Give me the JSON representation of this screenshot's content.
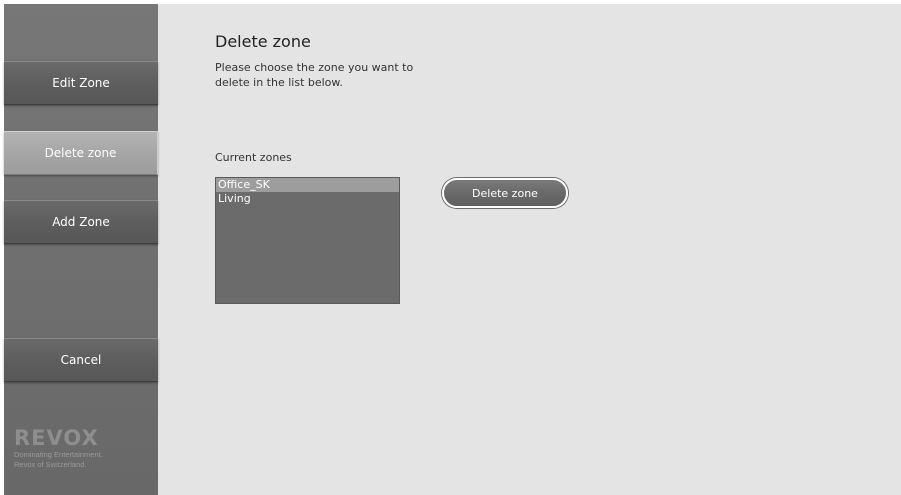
{
  "sidebar": {
    "items": [
      {
        "label": "Edit Zone"
      },
      {
        "label": "Delete zone"
      },
      {
        "label": "Add Zone"
      }
    ],
    "cancel_label": "Cancel"
  },
  "brand": {
    "wordmark": "REVOX",
    "tagline_1": "Dominating Entertainment.",
    "tagline_2": "Revox of Switzerland."
  },
  "main": {
    "title": "Delete zone",
    "description": "Please choose the zone you want to delete in the list below.",
    "list_label": "Current zones",
    "zones": [
      {
        "name": "Office_SK",
        "selected": true
      },
      {
        "name": "Living",
        "selected": false
      }
    ],
    "delete_button_label": "Delete zone"
  },
  "colors": {
    "background": "#e4e4e4",
    "sidebar": "#707070",
    "active_nav": "#a6a6a6",
    "list_bg": "#6b6b6b",
    "selected_row": "#9d9d9d"
  }
}
